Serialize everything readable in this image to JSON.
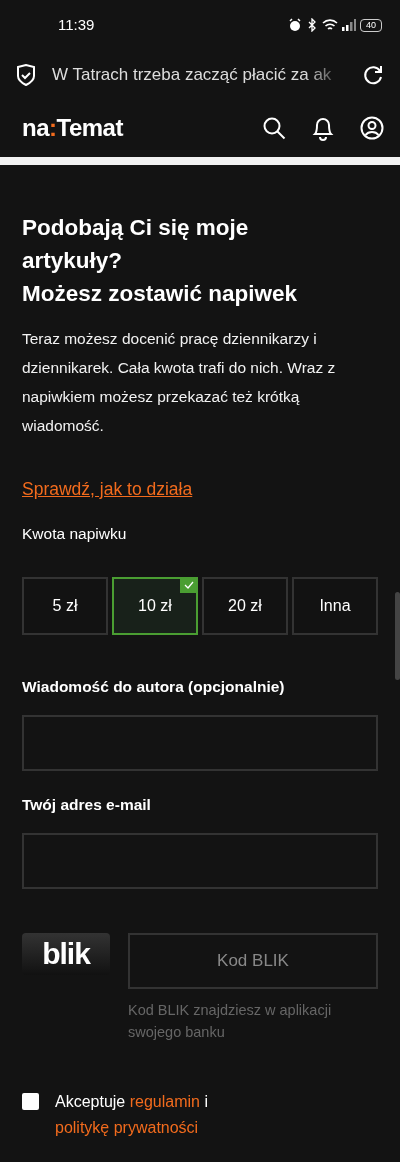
{
  "status_bar": {
    "time": "11:39",
    "battery": "40"
  },
  "address_bar": {
    "title": "W Tatrach trzeba zacząć płacić za ak"
  },
  "header": {
    "logo": {
      "before": "na",
      "separator": ":",
      "after": "Temat"
    }
  },
  "tip_form": {
    "heading": [
      "Podobają Ci się moje artykuły?",
      "Możesz zostawić napiwek"
    ],
    "description": "Teraz możesz docenić pracę dziennikarzy i dziennikarek. Cała kwota trafi do nich. Wraz z napiwkiem możesz przekazać też krótką wiadomość.",
    "how_link": "Sprawdź, jak to działa",
    "amount_label": "Kwota napiwku",
    "amounts": [
      {
        "label": "5 zł",
        "selected": false
      },
      {
        "label": "10 zł",
        "selected": true
      },
      {
        "label": "20 zł",
        "selected": false
      },
      {
        "label": "Inna",
        "selected": false
      }
    ],
    "message_label": "Wiadomość do autora (opcjonalnie)",
    "email_label": "Twój adres e-mail",
    "blik": {
      "logo": "blik",
      "placeholder": "Kod BLIK",
      "hint": "Kod BLIK znajdziesz w aplikacji swojego banku"
    },
    "consent": {
      "checked": false,
      "text": "Akceptuje",
      "terms_link": "regulamin",
      "conjunction": "i",
      "privacy_link": "politykę prywatności"
    }
  }
}
